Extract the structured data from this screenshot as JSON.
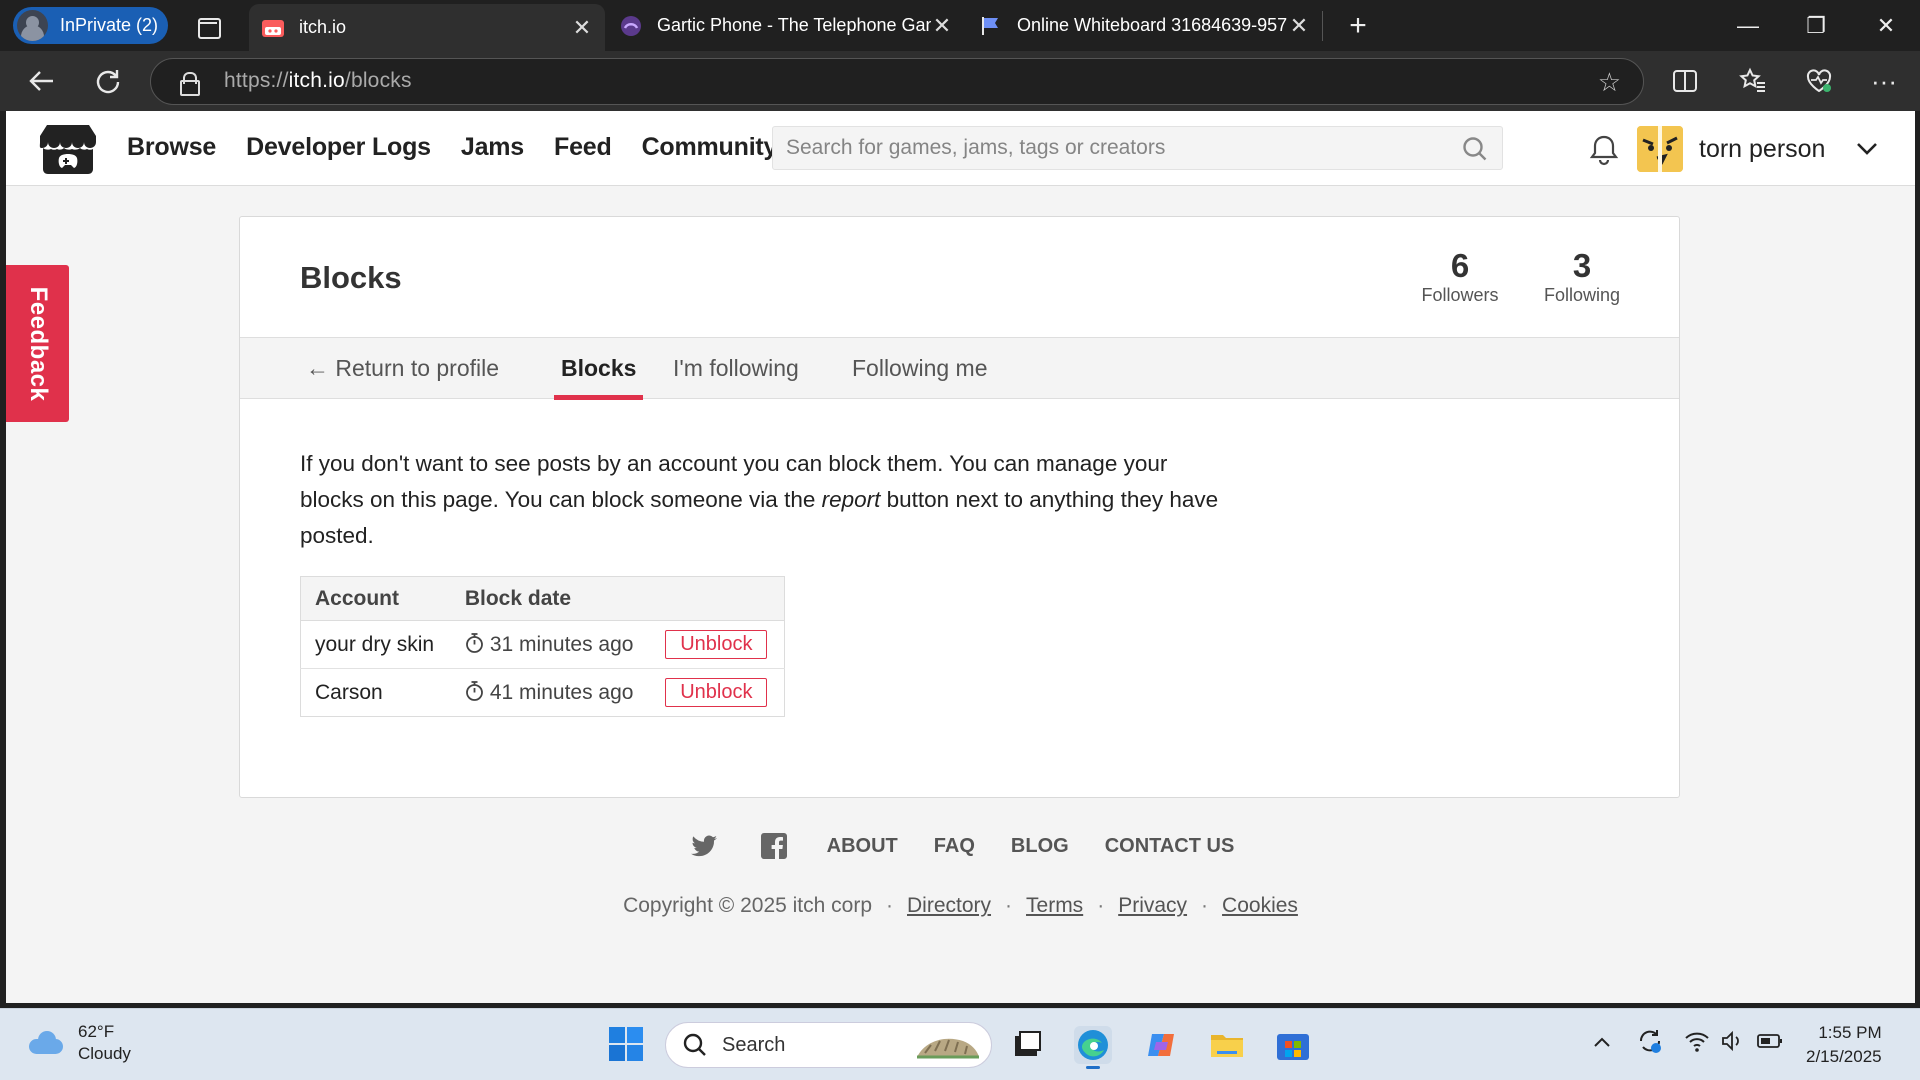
{
  "browser": {
    "inprivate_label": "InPrivate (2)",
    "tabs": [
      {
        "title": "itch.io",
        "active": true
      },
      {
        "title": "Gartic Phone - The Telephone Game",
        "active": false
      },
      {
        "title": "Online Whiteboard 31684639-957",
        "active": false
      }
    ],
    "url_scheme": "https://",
    "url_host": "itch.io",
    "url_path": "/blocks"
  },
  "header": {
    "nav": [
      "Browse",
      "Developer Logs",
      "Jams",
      "Feed",
      "Community"
    ],
    "search_placeholder": "Search for games, jams, tags or creators",
    "username": "torn person"
  },
  "feedback_label": "Feedback",
  "card": {
    "title": "Blocks",
    "stats": [
      {
        "num": "6",
        "label": "Followers"
      },
      {
        "num": "3",
        "label": "Following"
      }
    ],
    "tabs": [
      {
        "label": "← Return to profile",
        "selected": false
      },
      {
        "label": "Blocks",
        "selected": true
      },
      {
        "label": "I'm following",
        "selected": false
      },
      {
        "label": "Following me",
        "selected": false
      }
    ],
    "desc_part1": "If you don't want to see posts by an account you can block them. You can manage your blocks on this page. You can block someone via the ",
    "desc_em": "report",
    "desc_part2": " button next to anything they have posted.",
    "table": {
      "headers": [
        "Account",
        "Block date"
      ],
      "rows": [
        {
          "account": "your dry skin",
          "date": "31 minutes ago",
          "action": "Unblock"
        },
        {
          "account": "Carson",
          "date": "41 minutes ago",
          "action": "Unblock"
        }
      ]
    }
  },
  "footer": {
    "links": [
      "ABOUT",
      "FAQ",
      "BLOG",
      "CONTACT US"
    ],
    "copyright": "Copyright © 2025 itch corp",
    "legal": [
      "Directory",
      "Terms",
      "Privacy",
      "Cookies"
    ]
  },
  "taskbar": {
    "temp": "62°F",
    "condition": "Cloudy",
    "search_label": "Search",
    "time": "1:55 PM",
    "date": "2/15/2025"
  },
  "colors": {
    "accent": "#e0314b",
    "inprivate": "#1a5fb4"
  }
}
